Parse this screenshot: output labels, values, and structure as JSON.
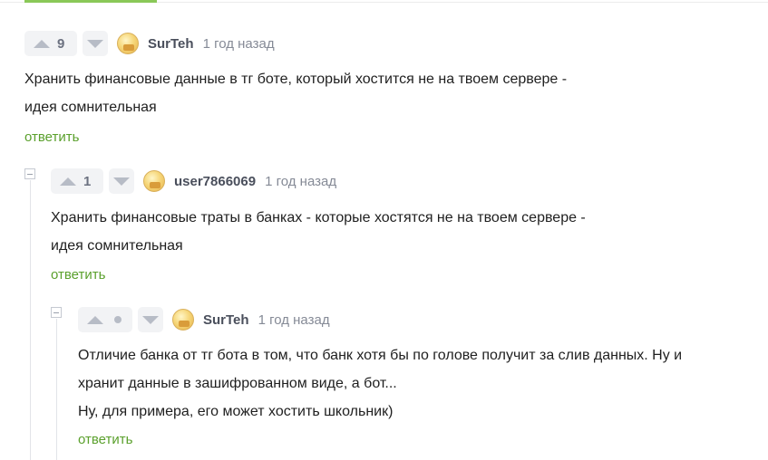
{
  "comments": [
    {
      "votes": "9",
      "author": "SurTeh",
      "time": "1 год назад",
      "lines": [
        "Хранить финансовые данные в тг боте, который хостится не на твоем сервере -",
        "идея сомнительная"
      ],
      "reply_label": "ответить"
    },
    {
      "votes": "1",
      "author": "user7866069",
      "time": "1 год назад",
      "lines": [
        "Хранить финансовые траты в банках - которые хостятся не на твоем сервере -",
        "идея сомнительная"
      ],
      "reply_label": "ответить"
    },
    {
      "author": "SurTeh",
      "time": "1 год назад",
      "lines": [
        "Отличие банка от тг бота в том, что банк хотя бы по голове получит за слив данных. Ну и",
        "хранит данные в зашифрованном виде, а бот...",
        "Ну, для примера, его может хостить школьник)"
      ],
      "reply_label": "ответить"
    }
  ],
  "colors": {
    "accent": "#8ac858",
    "reply": "#5aa02c",
    "vote_bg": "#f2f3f5",
    "vote_arrow": "#b7bcc6"
  },
  "icons": [
    "arrow-up-icon",
    "arrow-down-icon",
    "avatar",
    "collapse-icon"
  ]
}
